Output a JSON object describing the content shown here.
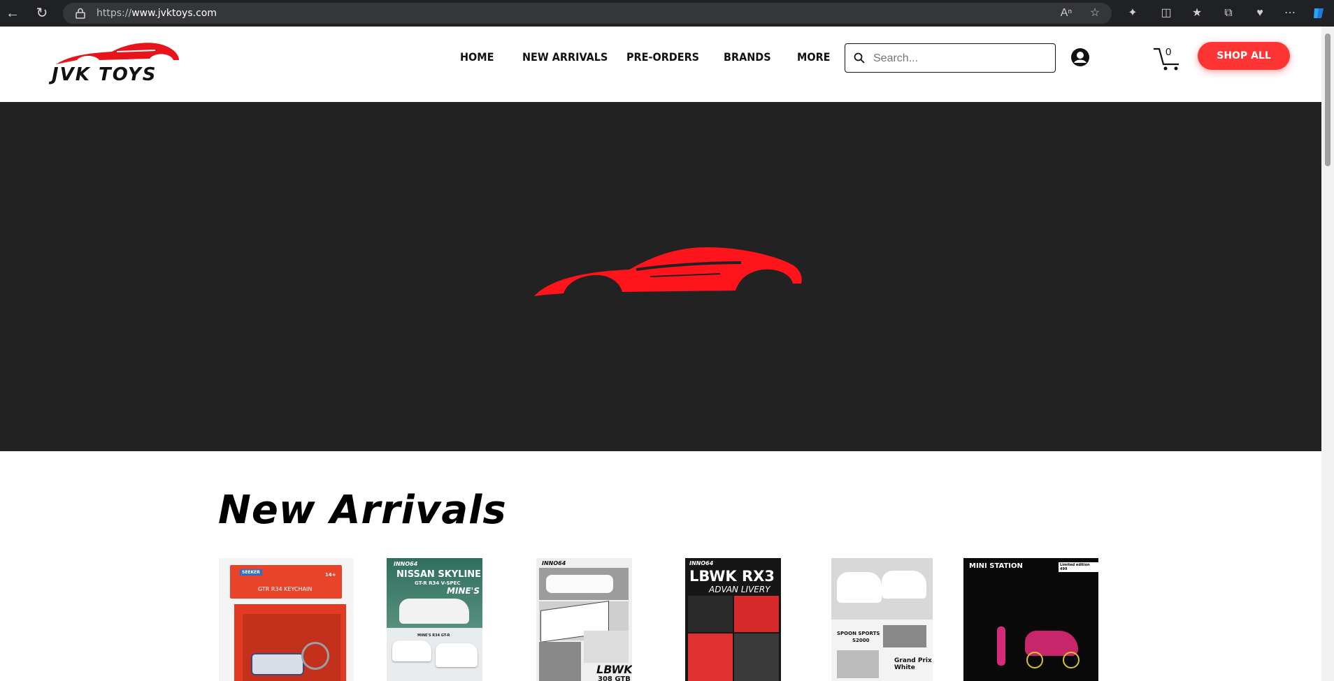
{
  "browser": {
    "url_prefix": "https://",
    "url_host": "www.jvktoys.com"
  },
  "header": {
    "logo_text": "JVK TOYS",
    "menu": [
      "HOME",
      "NEW ARRIVALS",
      "PRE-ORDERS",
      "BRANDS",
      "MORE"
    ],
    "search_placeholder": "Search...",
    "cart_count": "0",
    "shop_all_label": "SHOP ALL"
  },
  "colors": {
    "accent": "#ff3434",
    "hero_bg": "#222222"
  },
  "new_arrivals": {
    "title": "New Arrivals",
    "products": [
      {
        "alt": "GTR R34 KEYCHAIN",
        "box_label": "GTR R34 KEYCHAIN",
        "badge": "SEEKER",
        "age": "14+"
      },
      {
        "alt": "NISSAN SKYLINE GT-R R34 V-SPEC MINE'S",
        "line1": "NISSAN SKYLINE",
        "line2": "GT-R R34 V-SPEC",
        "line3": "MINE'S",
        "sub": "MINE'S R34 GT-R"
      },
      {
        "alt": "LBWK 308 GTB",
        "line1": "LBWK",
        "line2": "308 GTB"
      },
      {
        "alt": "LBWK RX3 ADVAN LIVERY",
        "line1": "LBWK RX3",
        "line2": "ADVAN LIVERY"
      },
      {
        "alt": "SPOON SPORTS S2000 Grand Prix White",
        "line1": "SPOON SPORTS",
        "line2": "S2000",
        "line3": "Grand Prix",
        "line4": "White"
      },
      {
        "alt": "MINI STATION Limited edition",
        "brand": "MINI STATION",
        "note": "Limited edition 499"
      }
    ]
  }
}
